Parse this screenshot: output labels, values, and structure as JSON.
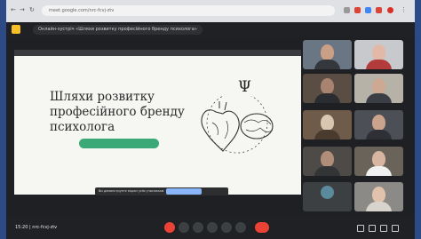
{
  "browser": {
    "url": "meet.google.com/nrc-fcvj-ztv"
  },
  "meet": {
    "title": "Онлайн-зустріч «Шляхи розвитку професійного бренду психолога»"
  },
  "slide": {
    "title": "Шляхи розвитку\nпрофесійного бренду\nпсихолога",
    "symbol": "Ψ"
  },
  "share_notice": {
    "text": "Ви демонструєте екран усім учасникам"
  },
  "footer": {
    "meeting_info": "15:20  |  nrc-fcvj-ztv"
  },
  "colors": {
    "accent_green": "#3aa977",
    "hangup_red": "#ea4335",
    "meet_yellow": "#f6c026",
    "page_bg": "#2b4a86"
  }
}
